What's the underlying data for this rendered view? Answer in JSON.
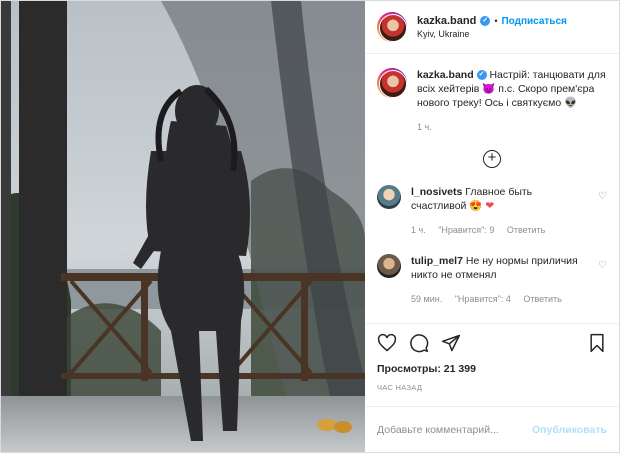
{
  "header": {
    "username": "kazka.band",
    "verified_mark": "✓",
    "separator": "•",
    "follow_label": "Подписаться",
    "location": "Kyiv, Ukraine"
  },
  "caption": {
    "username": "kazka.band",
    "text": "Настрій: танцювати для всіх хейтерів",
    "emoji1": "😈",
    "text2": "п.с. Скоро прем'єра нового треку! Ось і святкуємо",
    "emoji2": "👽",
    "time": "1 ч."
  },
  "load_more_icon": "plus-circle-icon",
  "comments": [
    {
      "username": "l_nosivets",
      "text": "Главное быть счастливой",
      "emoji1": "😍",
      "emoji2": "❤",
      "time": "1 ч.",
      "likes": "\"Нравится\": 9",
      "reply": "Ответить"
    },
    {
      "username": "tulip_mel7",
      "text": "Не ну нормы приличия никто не отменял",
      "time": "59 мин.",
      "likes": "\"Нравится\": 4",
      "reply": "Ответить"
    }
  ],
  "action_icons": [
    "heart-icon",
    "comment-icon",
    "share-icon",
    "bookmark-icon"
  ],
  "views": "Просмотры: 21 399",
  "posted_time": "ЧАС НАЗАД",
  "add_comment": {
    "placeholder": "Добавьте комментарий...",
    "publish_label": "Опубликовать"
  },
  "colors": {
    "accent": "#0095f6",
    "publish_disabled": "#b2dffc",
    "muted": "#8e8e8e",
    "border": "#dbdbdb"
  }
}
